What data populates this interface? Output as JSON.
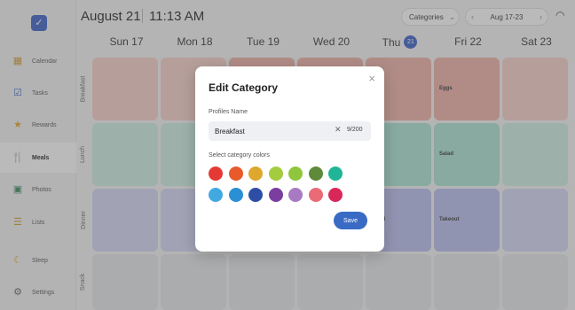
{
  "header": {
    "date": "August 21",
    "time": "11:13 AM",
    "categories_label": "Categories",
    "date_range": "Aug 17-23"
  },
  "sidebar": {
    "items": [
      {
        "label": "Calendar",
        "icon": "calendar-icon"
      },
      {
        "label": "Tasks",
        "icon": "checkbox-icon"
      },
      {
        "label": "Rewards",
        "icon": "star-icon"
      },
      {
        "label": "Meals",
        "icon": "utensils-icon"
      },
      {
        "label": "Photos",
        "icon": "photo-icon"
      },
      {
        "label": "Lists",
        "icon": "list-icon"
      },
      {
        "label": "Sleep",
        "icon": "moon-icon"
      },
      {
        "label": "Settings",
        "icon": "gear-icon"
      }
    ]
  },
  "calendar": {
    "days": [
      {
        "label": "Sun 17"
      },
      {
        "label": "Mon 18"
      },
      {
        "label": "Tue 19"
      },
      {
        "label": "Wed 20"
      },
      {
        "label": "Thu",
        "badge": "21"
      },
      {
        "label": "Fri 22"
      },
      {
        "label": "Sat 23"
      }
    ],
    "rows": [
      "Breakfast",
      "Lunch",
      "Dinner",
      "Snack"
    ],
    "meals": {
      "thu_breakfast": "als",
      "fri_breakfast": "Eggs",
      "thu_lunch": "a",
      "fri_lunch": "Salad",
      "thu_dinner": "ghetti",
      "fri_dinner": "Takeout"
    }
  },
  "dialog": {
    "title": "Edit Category",
    "profiles_label": "Profiles Name",
    "name_value": "Breakfast",
    "char_count": "9/200",
    "colors_label": "Select category colors",
    "save_label": "Save",
    "colors": [
      "#e53935",
      "#e85a2a",
      "#dea72e",
      "#a3cc3f",
      "#8fc63d",
      "#5e8a3a",
      "#1fb596",
      "#42a9e0",
      "#2b8fd4",
      "#2d4ea4",
      "#7b3ea0",
      "#a97ac4",
      "#ea6a75",
      "#d8285a"
    ]
  },
  "theme": {
    "accent": "#3a5fc8",
    "breakfast_color": "#f0b0a6",
    "lunch_color": "#a9e4d2",
    "dinner_color": "#b8bdf0"
  }
}
